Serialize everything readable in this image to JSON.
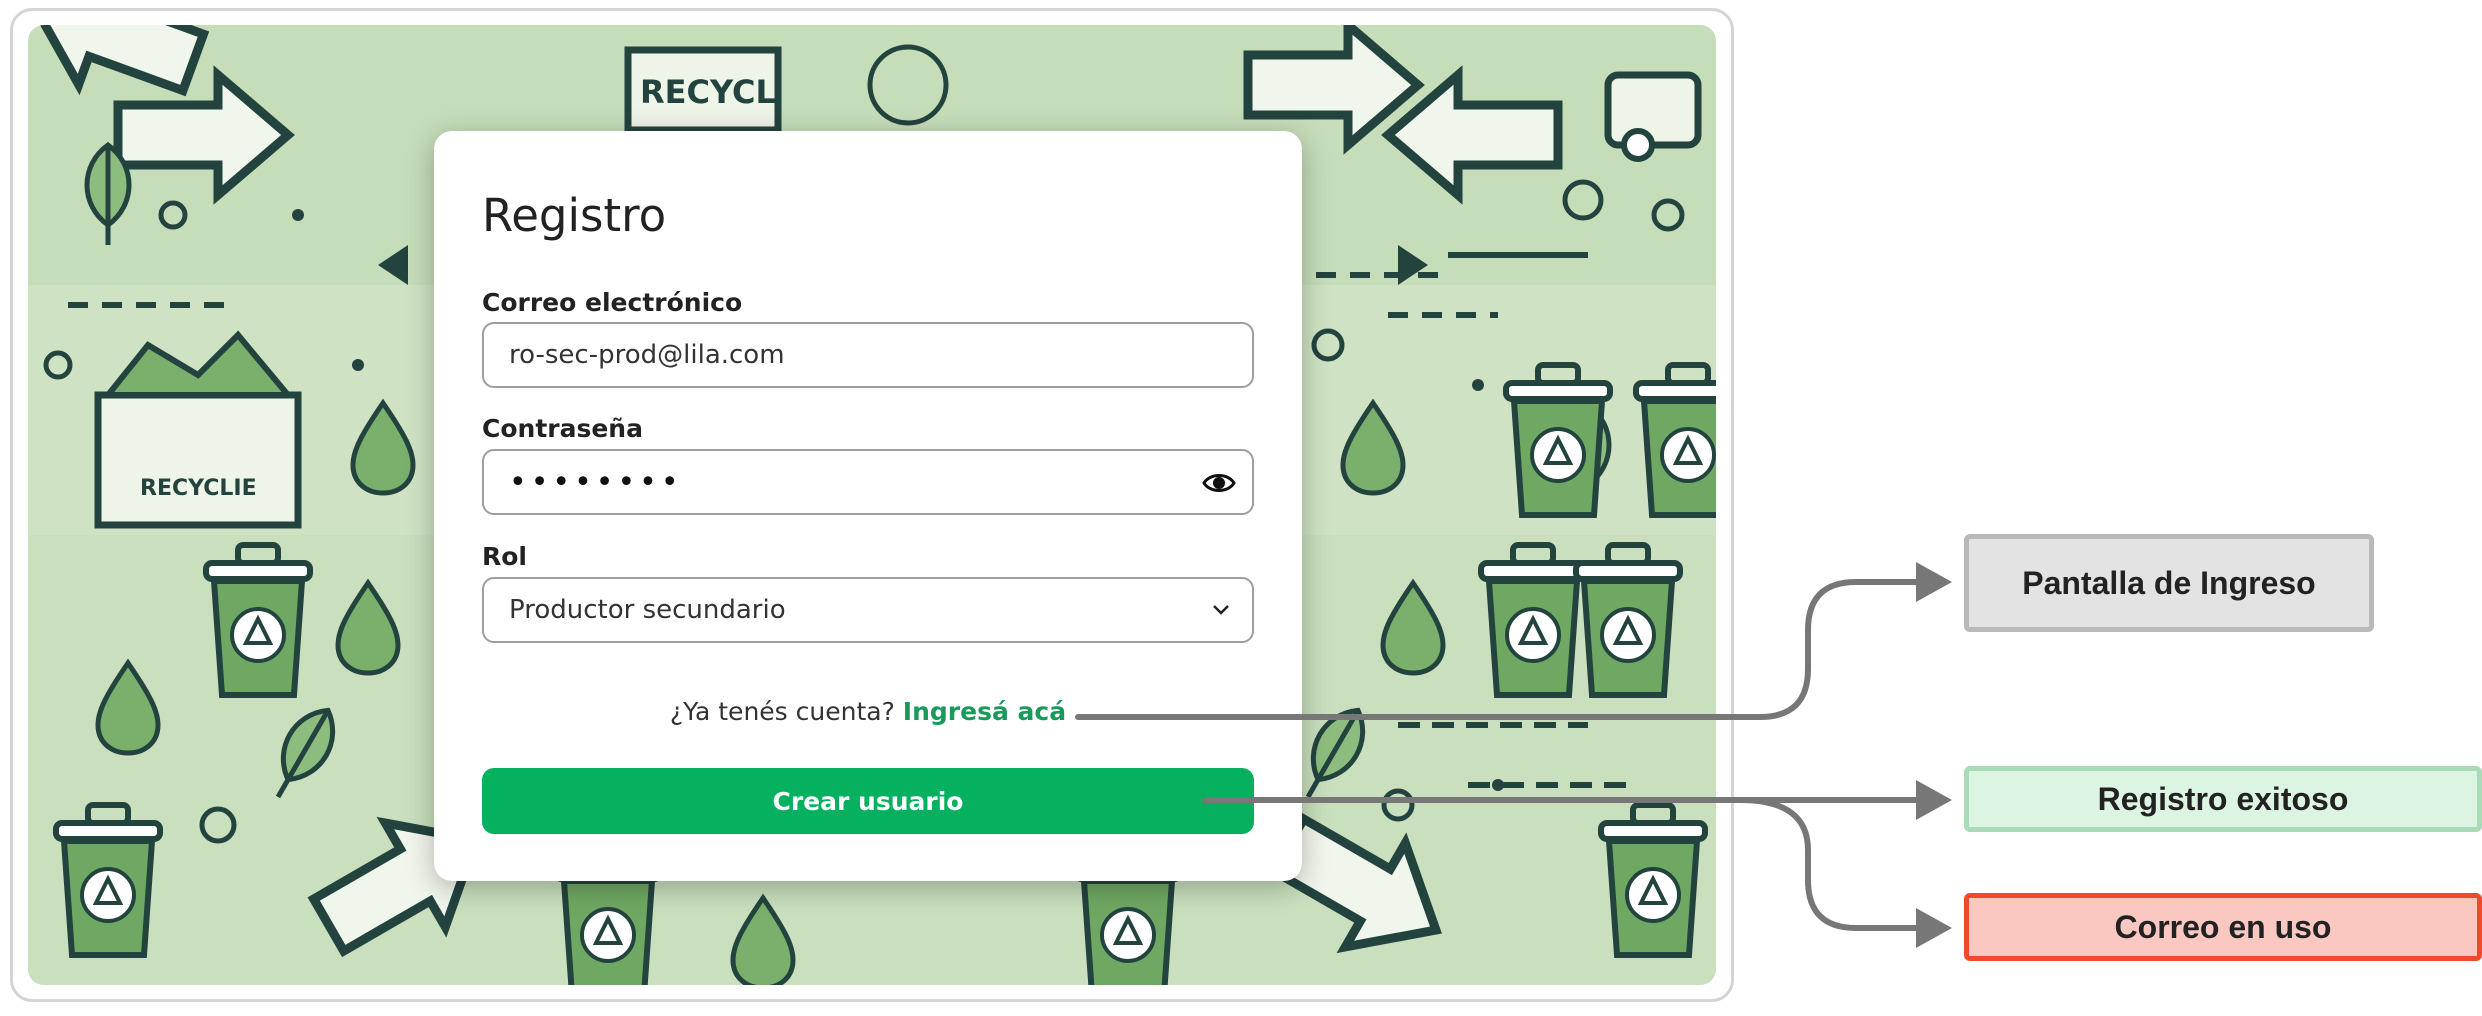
{
  "form": {
    "title": "Registro",
    "email_label": "Correo electrónico",
    "email_value": "ro-sec-prod@lila.com",
    "password_label": "Contraseña",
    "password_value": "••••••••",
    "role_label": "Rol",
    "role_value": "Productor secundario",
    "login_prompt": "¿Ya tenés cuenta?",
    "login_link": "Ingresá acá",
    "submit_label": "Crear usuario"
  },
  "background": {
    "recycle_text_1": "RECYCL",
    "recycle_text_2": "RECYCLIE"
  },
  "flow": {
    "ingreso": "Pantalla de Ingreso",
    "exitoso": "Registro exitoso",
    "en_uso": "Correo en uso"
  },
  "colors": {
    "primary": "#05b05f",
    "link": "#1a9a5a",
    "background_green": "#cfe3c4",
    "error_border": "#ef4a2e"
  }
}
